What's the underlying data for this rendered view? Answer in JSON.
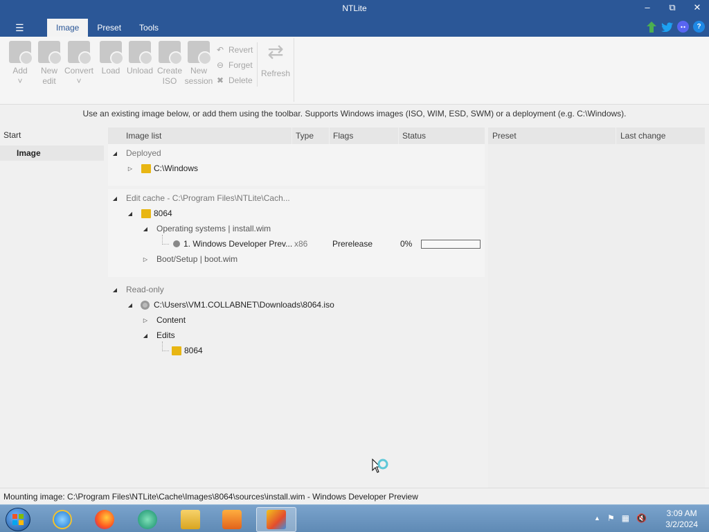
{
  "window": {
    "title": "NTLite"
  },
  "window_controls": {
    "minimize": "‒",
    "restore": "⧉",
    "close": "✕"
  },
  "ribbon": {
    "menu_icon": "☰",
    "tabs": [
      {
        "label": "Image",
        "active": true
      },
      {
        "label": "Preset"
      },
      {
        "label": "Tools"
      }
    ]
  },
  "social_icons": [
    "update-arrow-icon",
    "twitter-icon",
    "discord-icon",
    "help-icon"
  ],
  "toolbar": {
    "add": [
      "Add",
      "˅"
    ],
    "new_edit": [
      "New",
      "edit"
    ],
    "convert": [
      "Convert",
      "˅"
    ],
    "load": [
      "Load"
    ],
    "unload": [
      "Unload"
    ],
    "create_iso": [
      "Create",
      "ISO"
    ],
    "new_session": [
      "New",
      "session"
    ],
    "revert": "Revert",
    "forget": "Forget",
    "delete": "Delete",
    "refresh": "Refresh"
  },
  "hint": "Use an existing image below, or add them using the toolbar. Supports Windows images (ISO, WIM, ESD, SWM) or a deployment (e.g. C:\\Windows).",
  "leftnav": {
    "start": "Start",
    "image": "Image"
  },
  "image_list": {
    "headers": {
      "name": "Image list",
      "type": "Type",
      "flags": "Flags",
      "status": "Status"
    },
    "deployed": {
      "label": "Deployed",
      "path": "C:\\Windows"
    },
    "edit_cache": {
      "label": "Edit cache - C:\\Program Files\\NTLite\\Cach...",
      "folder": "8064",
      "os_label": "Operating systems  |  install.wim",
      "image_name": "1. Windows Developer Prev...",
      "image_arch": "x86",
      "image_flags": "Prerelease",
      "image_status": "0%",
      "progress_fraction": 0,
      "boot_label": "Boot/Setup  |  boot.wim"
    },
    "read_only": {
      "label": "Read-only",
      "iso_path": "C:\\Users\\VM1.COLLABNET\\Downloads\\8064.iso",
      "content": "Content",
      "edits": "Edits",
      "edit_folder": "8064"
    }
  },
  "right_panel": {
    "headers": {
      "preset": "Preset",
      "last_change": "Last change"
    }
  },
  "statusbar": "Mounting image: C:\\Program Files\\NTLite\\Cache\\Images\\8064\\sources\\install.wim - Windows Developer Preview",
  "taskbar": {
    "apps": [
      "internet-explorer-icon",
      "firefox-icon",
      "app-icon",
      "file-explorer-icon",
      "media-player-icon",
      "ntlite-icon"
    ],
    "tray_up": "▲",
    "clock": {
      "time": "3:09 AM",
      "date": "3/2/2024"
    }
  },
  "colors": {
    "titlebar": "#2b5797",
    "accent": "#2b5797"
  }
}
